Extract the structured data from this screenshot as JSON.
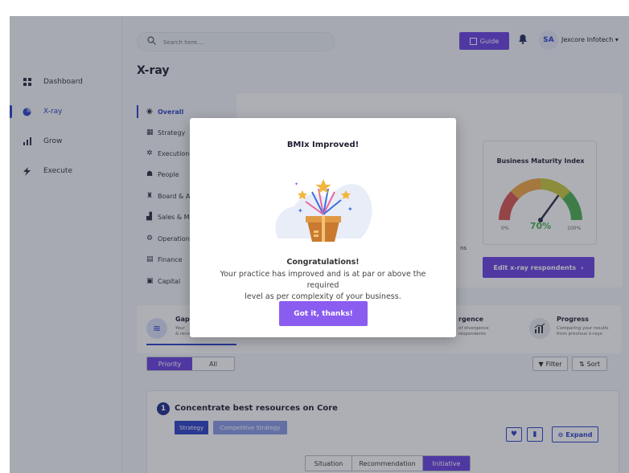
{
  "sidebar": {
    "items": [
      {
        "label": "Dashboard",
        "icon": "dashboard-grid-icon"
      },
      {
        "label": "X-ray",
        "icon": "pie-chart-icon",
        "active": true
      },
      {
        "label": "Grow",
        "icon": "bar-chart-icon"
      },
      {
        "label": "Execute",
        "icon": "lightning-icon"
      }
    ]
  },
  "header": {
    "search_placeholder": "Search here....",
    "guide_label": "Guide",
    "avatar_initials": "SA",
    "org_name": "Jexcore Infotech"
  },
  "page": {
    "title": "X-ray"
  },
  "submenu": {
    "items": [
      {
        "label": "Overall",
        "icon": "target-icon",
        "active": true
      },
      {
        "label": "Strategy",
        "icon": "strategy-icon"
      },
      {
        "label": "Execution",
        "icon": "execution-icon"
      },
      {
        "label": "People",
        "icon": "people-icon"
      },
      {
        "label": "Board & A",
        "icon": "board-icon"
      },
      {
        "label": "Sales & M",
        "icon": "sales-icon"
      },
      {
        "label": "Operation",
        "icon": "gears-icon"
      },
      {
        "label": "Finance",
        "icon": "finance-icon"
      },
      {
        "label": "Capital",
        "icon": "capital-icon"
      }
    ]
  },
  "bmi": {
    "title": "Business Maturity Index",
    "min_label": "0%",
    "max_label": "100%",
    "value_label": "70%",
    "value": 70,
    "edit_label": "Edit x-ray respondents"
  },
  "partial_text": "ns",
  "tabs": {
    "gap": {
      "title": "Gap",
      "desc_line1": "Your",
      "desc_line2": "& recommendations",
      "desc": "Your & recommendations"
    },
    "divergence": {
      "title": "rgence",
      "desc_line1": "of divergence",
      "desc_line2": "respondents"
    },
    "progress": {
      "title": "Progress",
      "desc_line1": "Comparing your results",
      "desc_line2": "from previous x-rays"
    }
  },
  "filters": {
    "priority_label": "Priority",
    "all_label": "All",
    "filter_label": "Filter",
    "sort_label": "Sort"
  },
  "recommendation": {
    "number": "1",
    "title": "Concentrate best resources on Core",
    "tags": [
      "Strategy",
      "Competitive Strategy"
    ],
    "expand_label": "Expand",
    "subtabs": [
      "Situation",
      "Recommendation",
      "Initiative"
    ],
    "active_subtab": "Initiative"
  },
  "modal": {
    "title": "BMIx Improved!",
    "heading": "Congratulations!",
    "message_line1": "Your practice has improved and is at par or above the required",
    "message_line2": "level as per complexity of your business.",
    "button_label": "Got it, thanks!"
  },
  "colors": {
    "accent": "#6a3fe0",
    "primary": "#2c3fc7",
    "gauge_red": "#d9534f",
    "gauge_orange": "#f0a640",
    "gauge_yellow": "#c9c93a",
    "gauge_green": "#4caf50",
    "value_green": "#4caf50"
  }
}
